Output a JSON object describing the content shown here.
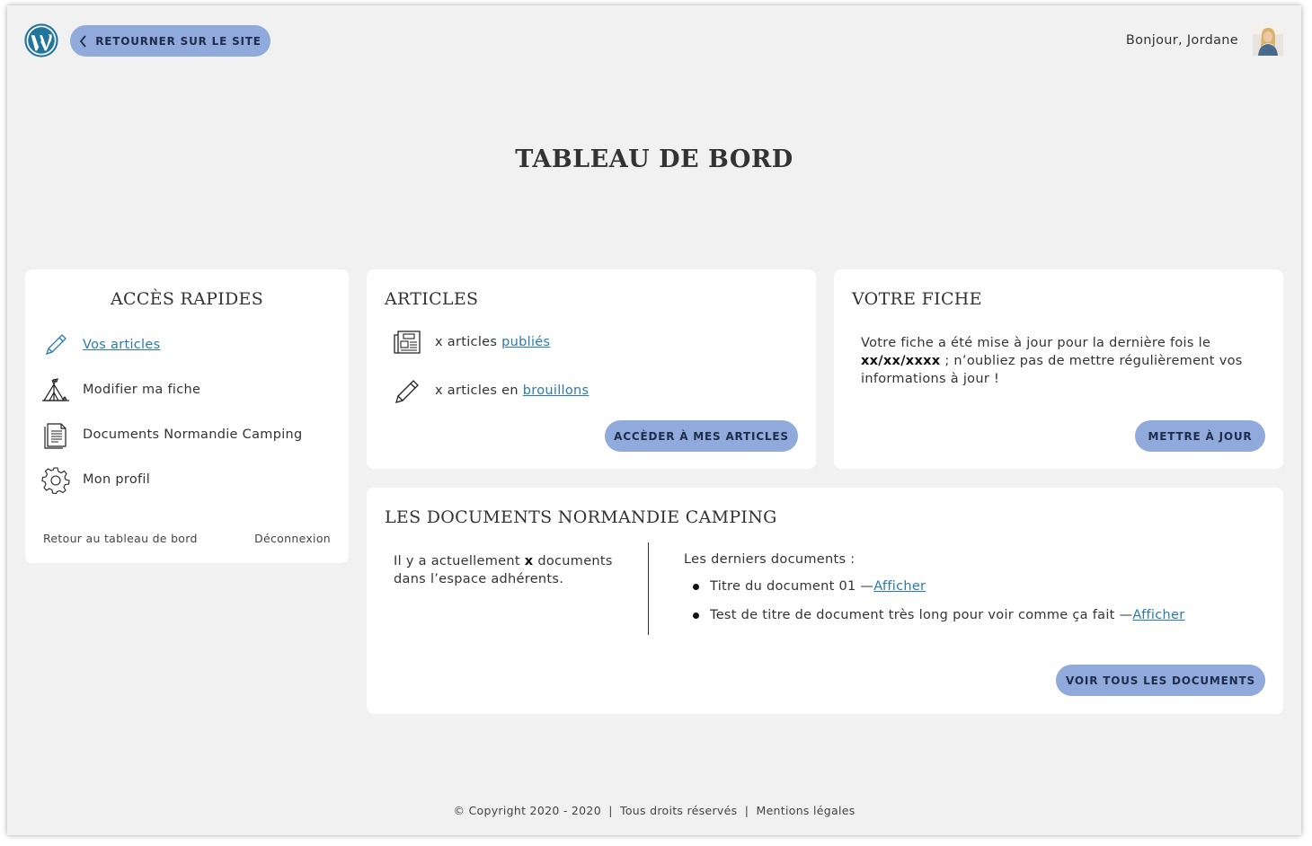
{
  "header": {
    "back_label": "RETOURNER SUR LE SITE",
    "greeting": "Bonjour, Jordane"
  },
  "page_title": "TABLEAU DE BORD",
  "quick_access": {
    "title": "ACCÈS RAPIDES",
    "items": [
      {
        "label": "Vos articles",
        "icon": "pencil-icon",
        "is_link": true
      },
      {
        "label": "Modifier ma fiche",
        "icon": "tent-icon"
      },
      {
        "label": "Documents Normandie Camping",
        "icon": "document-icon"
      },
      {
        "label": "Mon profil",
        "icon": "gear-icon"
      }
    ],
    "footer_left": "Retour au tableau de bord",
    "footer_right": "Déconnexion"
  },
  "articles": {
    "title": "ARTICLES",
    "published_prefix": "x articles ",
    "published_link": "publiés",
    "drafts_prefix": "x articles en ",
    "drafts_link": "brouillons",
    "button": "ACCÈDER À MES ARTICLES"
  },
  "fiche": {
    "title": "VOTRE FICHE",
    "text_before": "Votre fiche a été mise à jour pour la dernière fois le ",
    "date": "xx/xx/xxxx",
    "text_after": " ; n’oubliez pas de mettre régulièrement vos informations à jour !",
    "button": "METTRE À JOUR"
  },
  "documents": {
    "title": "LES DOCUMENTS NORMANDIE CAMPING",
    "count_before": "Il y a actuellement ",
    "count": "x",
    "count_after": " documents dans l’espace adhérents.",
    "latest_label": "Les derniers documents :",
    "items": [
      {
        "title": "Titre du document 01 — ",
        "link": "Afficher"
      },
      {
        "title": "Test de titre de document très long pour voir comme ça fait — ",
        "link": "Afficher"
      }
    ],
    "button": "VOIR TOUS LES DOCUMENTS"
  },
  "footer": {
    "copyright": "© Copyright 2020 - 2020",
    "rights": "Tous droits réservés",
    "legal": "Mentions légales",
    "separator": "|"
  },
  "colors": {
    "background": "#f1f1f1",
    "button": "#90aadb",
    "link": "#2a7ab0",
    "wp_logo": "#21759b"
  }
}
